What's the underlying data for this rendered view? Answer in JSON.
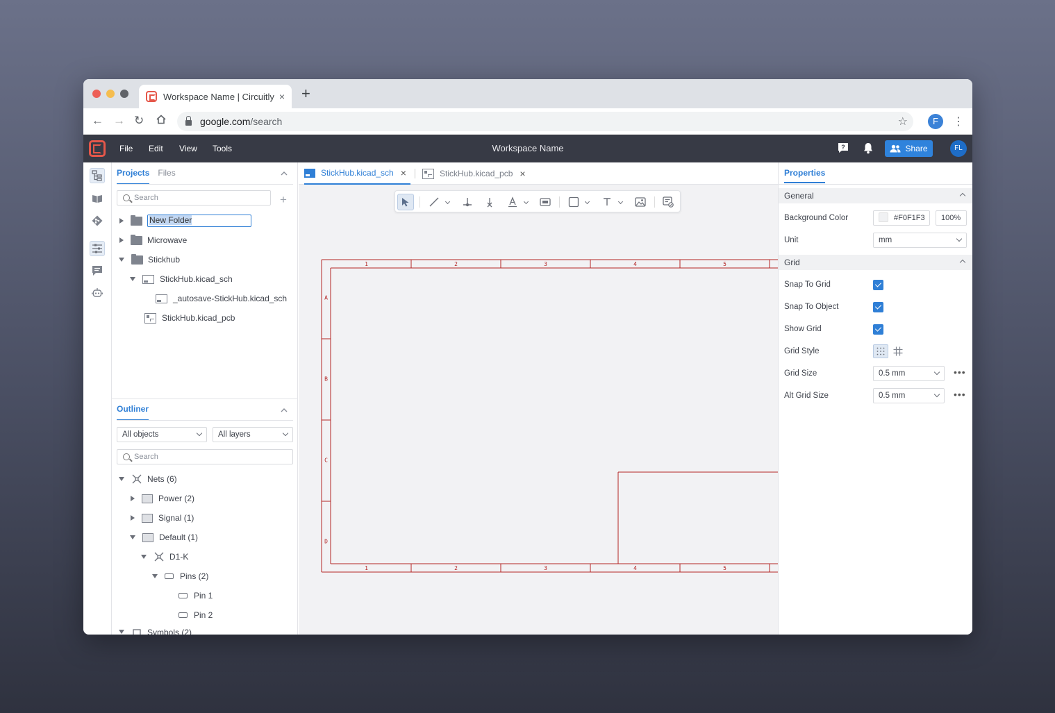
{
  "browser": {
    "tab_title": "Workspace Name | Circuitly",
    "tab_close": "×",
    "new_tab": "+",
    "url_host": "google.com",
    "url_path": "/search",
    "profile_initial": "F"
  },
  "app": {
    "menus": [
      "File",
      "Edit",
      "View",
      "Tools"
    ],
    "workspace_name": "Workspace Name",
    "share_label": "Share",
    "avatar_initials": "FL"
  },
  "projects_panel": {
    "tabs": [
      "Projects",
      "Files"
    ],
    "search_placeholder": "Search",
    "tree": {
      "new_folder": "New Folder",
      "microwave": "Microwave",
      "stickhub": "Stickhub",
      "sch_file": "StickHub.kicad_sch",
      "autosave_file": "_autosave-StickHub.kicad_sch",
      "pcb_file": "StickHub.kicad_pcb"
    }
  },
  "outliner": {
    "title": "Outliner",
    "objects_filter": "All objects",
    "layers_filter": "All layers",
    "search_placeholder": "Search",
    "nets": "Nets (6)",
    "power": "Power (2)",
    "signal": "Signal (1)",
    "default": "Default (1)",
    "d1k": "D1-K",
    "pins": "Pins (2)",
    "pin1": "Pin 1",
    "pin2": "Pin 2",
    "symbols": "Symbols (2)"
  },
  "editor": {
    "tabs": {
      "sch": "StickHub.kicad_sch",
      "pcb": "StickHub.kicad_pcb",
      "close": "×"
    },
    "sheet": {
      "columns": [
        "1",
        "2",
        "3",
        "4",
        "5"
      ],
      "rows": [
        "A",
        "B",
        "C",
        "D"
      ],
      "frame_color": "#b42525"
    }
  },
  "properties": {
    "title": "Properties",
    "general": "General",
    "background_color_label": "Background Color",
    "background_color_value": "#F0F1F3",
    "opacity": "100%",
    "unit_label": "Unit",
    "unit_value": "mm",
    "grid": "Grid",
    "snap_to_grid": "Snap To Grid",
    "snap_to_object": "Snap To Object",
    "show_grid": "Show Grid",
    "grid_style": "Grid Style",
    "grid_size_label": "Grid Size",
    "grid_size_value": "0.5 mm",
    "alt_grid_size_label": "Alt Grid Size",
    "alt_grid_size_value": "0.5 mm",
    "more": "•••"
  },
  "colors": {
    "accent": "#2f7fd6",
    "appbar": "#373a45",
    "logo": "#e5574a"
  }
}
